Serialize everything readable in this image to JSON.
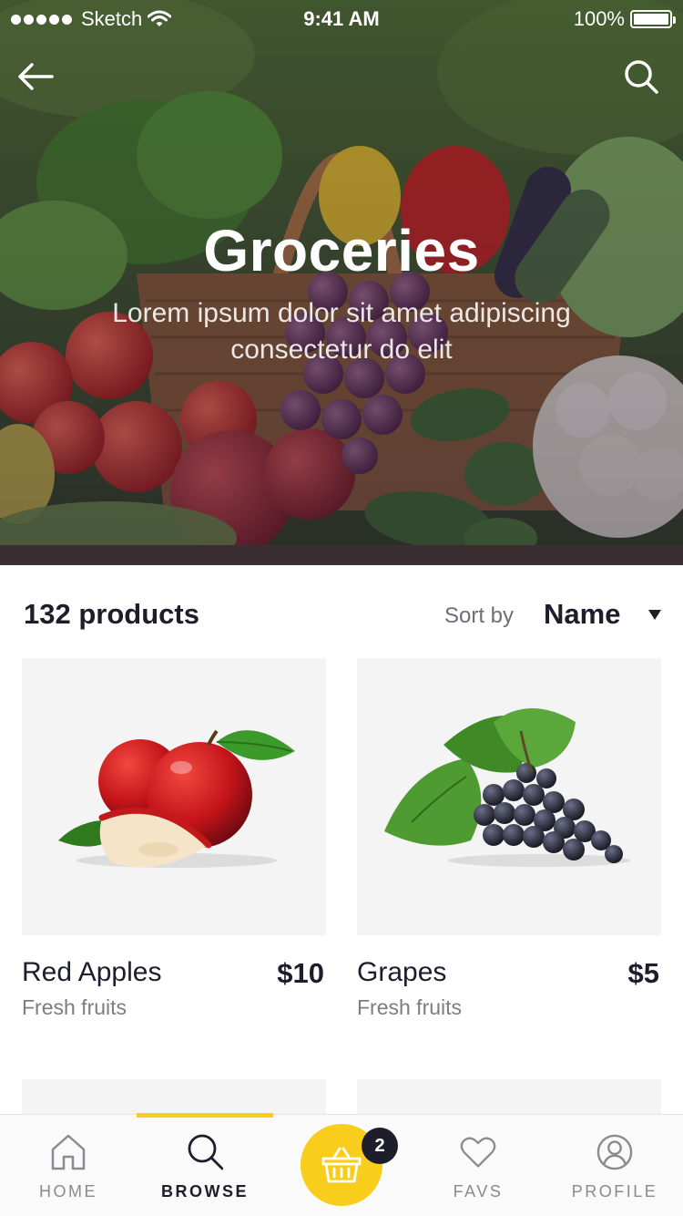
{
  "status_bar": {
    "carrier": "Sketch",
    "time": "9:41 AM",
    "battery": "100%"
  },
  "hero": {
    "title": "Groceries",
    "subtitle": "Lorem ipsum dolor sit amet adipiscing consectetur do elit"
  },
  "nav": {
    "back_icon": "arrow-left-icon",
    "search_icon": "search-icon"
  },
  "list": {
    "count": "132 products",
    "sort_label": "Sort by",
    "sort_value": "Name"
  },
  "products": [
    {
      "name": "Red Apples",
      "price": "$10",
      "category": "Fresh fruits",
      "icon": "apples-image"
    },
    {
      "name": "Grapes",
      "price": "$5",
      "category": "Fresh fruits",
      "icon": "grapes-image"
    }
  ],
  "tab_bar": {
    "tabs": [
      {
        "label": "HOME",
        "icon": "home-icon",
        "active": false
      },
      {
        "label": "BROWSE",
        "icon": "search-icon",
        "active": true
      },
      {
        "label": "FAVS",
        "icon": "heart-icon",
        "active": false
      },
      {
        "label": "PROFILE",
        "icon": "profile-icon",
        "active": false
      }
    ],
    "cart_badge": "2",
    "cart_icon": "basket-icon"
  },
  "colors": {
    "accent": "#f8cd1b",
    "text_dark": "#1d1d2c",
    "text_muted": "#7b7c84",
    "card_bg": "#f4f4f4"
  }
}
